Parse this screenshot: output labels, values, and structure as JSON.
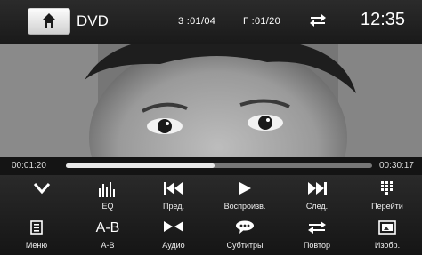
{
  "header": {
    "source": "DVD",
    "chapter": "3 :01/04",
    "title": "Г :01/20",
    "clock": "12:35"
  },
  "playback": {
    "elapsed": "00:01:20",
    "total": "00:30:17",
    "progress_fraction": 0.485
  },
  "controls": {
    "row1": [
      {
        "icon": "chevron-down-icon",
        "label": ""
      },
      {
        "icon": "equalizer-icon",
        "label": "EQ"
      },
      {
        "icon": "previous-track-icon",
        "label": "Пред."
      },
      {
        "icon": "play-icon",
        "label": "Воспроизв."
      },
      {
        "icon": "next-track-icon",
        "label": "След."
      },
      {
        "icon": "keypad-icon",
        "label": "Перейти"
      }
    ],
    "row2": [
      {
        "icon": "menu-icon",
        "label": "Меню"
      },
      {
        "icon": "ab-repeat-icon",
        "label": "A-B",
        "glyph": "A-B"
      },
      {
        "icon": "audio-icon",
        "label": "Аудио"
      },
      {
        "icon": "subtitles-icon",
        "label": "Субтитры"
      },
      {
        "icon": "repeat-icon",
        "label": "Повтор"
      },
      {
        "icon": "image-settings-icon",
        "label": "Изобр."
      }
    ]
  },
  "colors": {
    "background": "#111111",
    "text": "#ffffff",
    "progress_fill": "#e8e8e8",
    "progress_track": "#777777"
  }
}
